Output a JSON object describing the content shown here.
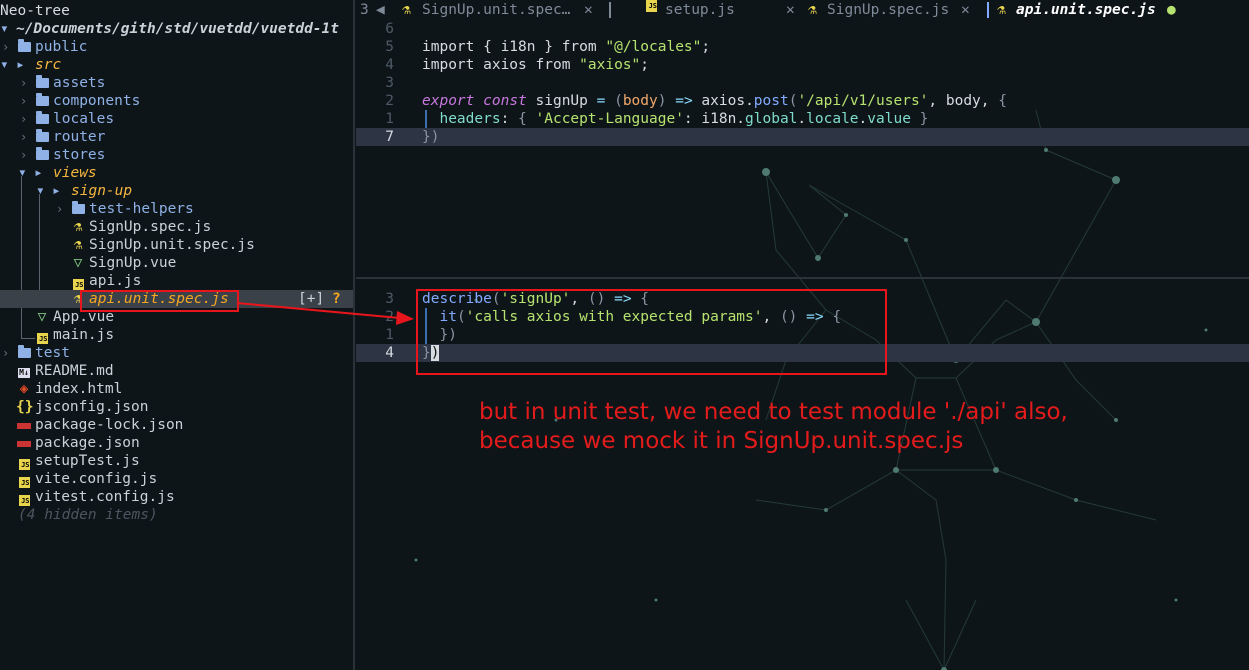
{
  "sidebar": {
    "title": "Neo-tree",
    "root_icon": "open-folder-icon",
    "root_path": "~/Documents/gith/std/vuetdd/vuetdd-1t",
    "items": [
      {
        "label": "public",
        "kind": "folder",
        "icon": "folder-icon",
        "toggle": "›"
      },
      {
        "label": "src",
        "kind": "folder-open",
        "icon": "open-folder-icon",
        "toggle": ""
      },
      {
        "label": "assets",
        "kind": "folder",
        "icon": "folder-icon",
        "toggle": "›"
      },
      {
        "label": "components",
        "kind": "folder",
        "icon": "folder-icon",
        "toggle": "›"
      },
      {
        "label": "locales",
        "kind": "folder",
        "icon": "folder-icon",
        "toggle": "›"
      },
      {
        "label": "router",
        "kind": "folder",
        "icon": "folder-icon",
        "toggle": "›"
      },
      {
        "label": "stores",
        "kind": "folder",
        "icon": "folder-icon",
        "toggle": "›"
      },
      {
        "label": "views",
        "kind": "folder-open",
        "icon": "open-folder-icon",
        "toggle": ""
      },
      {
        "label": "sign-up",
        "kind": "folder-open",
        "icon": "open-folder-icon",
        "toggle": ""
      },
      {
        "label": "test-helpers",
        "kind": "folder",
        "icon": "folder-icon",
        "toggle": "›"
      },
      {
        "label": "SignUp.spec.js",
        "kind": "file",
        "icon": "test-flask-icon"
      },
      {
        "label": "SignUp.unit.spec.js",
        "kind": "file",
        "icon": "test-flask-icon"
      },
      {
        "label": "SignUp.vue",
        "kind": "file",
        "icon": "vue-icon"
      },
      {
        "label": "api.js",
        "kind": "file",
        "icon": "js-icon"
      },
      {
        "label": "api.unit.spec.js",
        "kind": "file",
        "icon": "test-flask-icon"
      },
      {
        "label": "App.vue",
        "kind": "file",
        "icon": "vue-icon"
      },
      {
        "label": "main.js",
        "kind": "file",
        "icon": "js-icon"
      },
      {
        "label": "test",
        "kind": "folder",
        "icon": "folder-icon",
        "toggle": "›"
      },
      {
        "label": "README.md",
        "kind": "file",
        "icon": "markdown-icon"
      },
      {
        "label": "index.html",
        "kind": "file",
        "icon": "html-icon"
      },
      {
        "label": "jsconfig.json",
        "kind": "file",
        "icon": "json-icon"
      },
      {
        "label": "package-lock.json",
        "kind": "file",
        "icon": "npm-icon"
      },
      {
        "label": "package.json",
        "kind": "file",
        "icon": "npm-icon"
      },
      {
        "label": "setupTest.js",
        "kind": "file",
        "icon": "js-icon"
      },
      {
        "label": "vite.config.js",
        "kind": "file",
        "icon": "js-icon"
      },
      {
        "label": "vitest.config.js",
        "kind": "file",
        "icon": "js-icon"
      }
    ],
    "hidden_note": "(4 hidden items)",
    "selected_status": "[+]",
    "selected_flag": "?"
  },
  "tabs": {
    "count": "3",
    "items": [
      {
        "label": "SignUp.unit.spec…",
        "icon": "test-flask-icon",
        "close": "✕"
      },
      {
        "label": "setup.js",
        "icon": "js-icon",
        "close": "✕"
      },
      {
        "label": "SignUp.spec.js",
        "icon": "test-flask-icon",
        "close": "✕"
      },
      {
        "label": "api.unit.spec.js",
        "icon": "test-flask-icon",
        "modified": "●"
      }
    ]
  },
  "editor_top": {
    "lines": [
      {
        "num": "6"
      },
      {
        "num": "5",
        "tokens": [
          [
            "kw-plain",
            "import"
          ],
          [
            "pl",
            " { i18n } "
          ],
          [
            "kw-plain",
            "from"
          ],
          [
            "pl",
            " "
          ],
          [
            "str",
            "\"@/locales\""
          ],
          [
            "pl",
            ";"
          ]
        ]
      },
      {
        "num": "4",
        "tokens": [
          [
            "kw-plain",
            "import"
          ],
          [
            "pl",
            " axios "
          ],
          [
            "kw-plain",
            "from"
          ],
          [
            "pl",
            " "
          ],
          [
            "str",
            "\"axios\""
          ],
          [
            "pl",
            ";"
          ]
        ]
      },
      {
        "num": "3"
      },
      {
        "num": "2",
        "tokens": [
          [
            "kw",
            "export"
          ],
          [
            "pl",
            " "
          ],
          [
            "kw",
            "const"
          ],
          [
            "pl",
            " signUp "
          ],
          [
            "op",
            "="
          ],
          [
            "pl",
            " "
          ],
          [
            "br",
            "("
          ],
          [
            "par",
            "body"
          ],
          [
            "br",
            ")"
          ],
          [
            "pl",
            " "
          ],
          [
            "op",
            "=>"
          ],
          [
            "pl",
            " axios."
          ],
          [
            "fn",
            "post"
          ],
          [
            "br",
            "("
          ],
          [
            "str",
            "'/api/v1/users'"
          ],
          [
            "pl",
            ", body, "
          ],
          [
            "br",
            "{"
          ]
        ]
      },
      {
        "num": "1",
        "tokens": [
          [
            "pl",
            "  "
          ],
          [
            "prop",
            "headers"
          ],
          [
            "pl",
            ": "
          ],
          [
            "br",
            "{"
          ],
          [
            "pl",
            " "
          ],
          [
            "str",
            "'Accept-Language'"
          ],
          [
            "pl",
            ": i18n."
          ],
          [
            "prop",
            "global"
          ],
          [
            "pl",
            "."
          ],
          [
            "prop",
            "locale"
          ],
          [
            "pl",
            "."
          ],
          [
            "prop",
            "value"
          ],
          [
            "pl",
            " "
          ],
          [
            "br",
            "}"
          ]
        ]
      },
      {
        "num": "7",
        "current": true,
        "tokens": [
          [
            "br",
            "})"
          ]
        ]
      }
    ]
  },
  "editor_bottom": {
    "lines": [
      {
        "num": "3",
        "tokens": [
          [
            "fn",
            "describe"
          ],
          [
            "br",
            "("
          ],
          [
            "str",
            "'signUp'"
          ],
          [
            "pl",
            ", "
          ],
          [
            "br",
            "()"
          ],
          [
            "pl",
            " "
          ],
          [
            "op",
            "=>"
          ],
          [
            "pl",
            " "
          ],
          [
            "br",
            "{"
          ]
        ]
      },
      {
        "num": "2",
        "tokens": [
          [
            "pl",
            "  "
          ],
          [
            "fn",
            "it"
          ],
          [
            "br",
            "("
          ],
          [
            "str",
            "'calls axios with expected params'"
          ],
          [
            "pl",
            ", "
          ],
          [
            "br",
            "()"
          ],
          [
            "pl",
            " "
          ],
          [
            "op",
            "=>"
          ],
          [
            "pl",
            " "
          ],
          [
            "br",
            "{"
          ]
        ]
      },
      {
        "num": "1",
        "tokens": [
          [
            "pl",
            "  "
          ],
          [
            "br",
            "})"
          ]
        ]
      },
      {
        "num": "4",
        "current": true,
        "tokens": [
          [
            "br",
            "}"
          ],
          [
            "cursor",
            ")"
          ]
        ]
      }
    ]
  },
  "annotation": {
    "line1": "but in unit test, we need to test module './api' also,",
    "line2": "because we mock it in SignUp.unit.spec.js",
    "color": "#e41b1b"
  },
  "colors": {
    "background": "#0e1519",
    "accent_orange": "#f5a623",
    "folder_blue": "#8fb1e6",
    "string_green": "#b6e36f",
    "annotation_red": "#e8161c"
  }
}
